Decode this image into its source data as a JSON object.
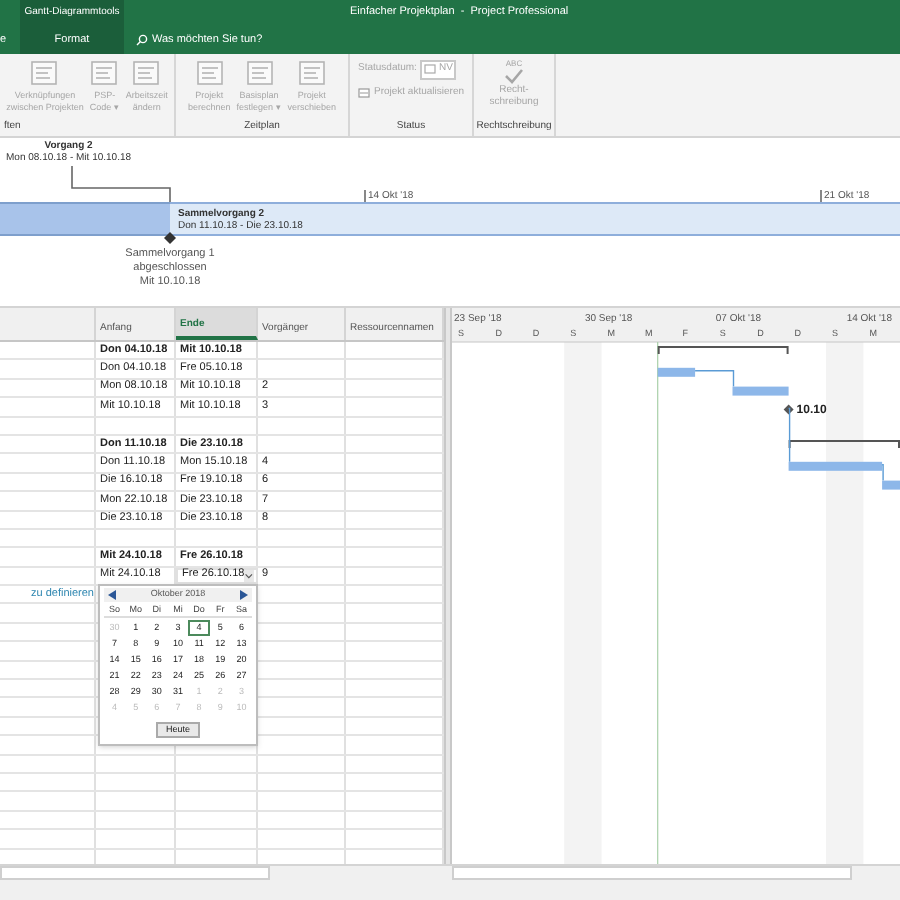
{
  "title_bar": {
    "tool_tab": "Gantt-Diagrammtools",
    "title": "Einfacher Projektplan  -  Project Professional"
  },
  "tabs": [
    {
      "label": "e",
      "selected": false
    },
    {
      "label": "Format",
      "selected": true
    }
  ],
  "search": {
    "placeholder": "Was möchten Sie tun?"
  },
  "ribbon": [
    {
      "kind": "buttons",
      "label": "ften",
      "buttons": [
        {
          "lines": [
            "Verknüpfungen",
            "zwischen Projekten"
          ],
          "disabled": true
        },
        {
          "lines": [
            "PSP-",
            "Code ▾"
          ],
          "disabled": true
        },
        {
          "lines": [
            "Arbeitszeit",
            "ändern"
          ],
          "disabled": true
        }
      ]
    },
    {
      "kind": "buttons",
      "label": "Zeitplan",
      "buttons": [
        {
          "lines": [
            "Projekt",
            "berechnen"
          ],
          "disabled": true
        },
        {
          "lines": [
            "Basisplan",
            "festlegen ▾"
          ],
          "disabled": true
        },
        {
          "lines": [
            "Projekt",
            "verschieben"
          ],
          "disabled": true
        }
      ]
    },
    {
      "kind": "status",
      "label": "Status",
      "date_label": "Statusdatum:",
      "date_value": "NV",
      "update": "Projekt aktualisieren",
      "disabled": true
    },
    {
      "kind": "spelling",
      "label": "Rechtschreibung",
      "badge": "ABC",
      "lines": [
        "Recht-",
        "schreibung"
      ],
      "disabled": true
    }
  ],
  "timeline": {
    "callout": {
      "title": "Vorgang 2",
      "dates": "Mon 08.10.18 - Mit 10.10.18"
    },
    "ticks": [
      "14 Okt '18",
      "21 Okt '18"
    ],
    "summary_bar": {
      "title": "Sammelvorgang 2",
      "dates": "Don 11.10.18 - Die 23.10.18"
    },
    "milestone": {
      "lines": [
        "Sammelvorgang 1",
        "abgeschlossen",
        "Mit 10.10.18"
      ]
    }
  },
  "table": {
    "columns": [
      {
        "label": "Anfang",
        "selected": false
      },
      {
        "label": "Ende",
        "selected": true
      },
      {
        "label": "Vorgänger",
        "selected": false
      },
      {
        "label": "Ressourcennamen",
        "selected": false
      }
    ],
    "rows": [
      {
        "kind": "summary",
        "start": "Don 04.10.18",
        "end": "Mit 10.10.18"
      },
      {
        "kind": "task",
        "start": "Don 04.10.18",
        "end": "Fre 05.10.18"
      },
      {
        "kind": "task",
        "start": "Mon 08.10.18",
        "end": "Mit 10.10.18",
        "pred": "2"
      },
      {
        "kind": "milestone",
        "start": "Mit 10.10.18",
        "end": "Mit 10.10.18",
        "pred": "3",
        "label": "10.10"
      },
      {
        "kind": "blank"
      },
      {
        "kind": "summary",
        "start": "Don 11.10.18",
        "end": "Die 23.10.18"
      },
      {
        "kind": "task",
        "start": "Don 11.10.18",
        "end": "Mon 15.10.18",
        "pred": "4"
      },
      {
        "kind": "task",
        "start": "Die 16.10.18",
        "end": "Fre 19.10.18",
        "pred": "6"
      },
      {
        "kind": "task",
        "start": "Mon 22.10.18",
        "end": "Die 23.10.18",
        "pred": "7"
      },
      {
        "kind": "milestone",
        "start": "Die 23.10.18",
        "end": "Die 23.10.18",
        "pred": "8"
      },
      {
        "kind": "blank"
      },
      {
        "kind": "summary",
        "start": "Mit 24.10.18",
        "end": "Fre 26.10.18"
      },
      {
        "kind": "task",
        "start": "Mit 24.10.18",
        "end": "Fre 26.10.18",
        "pred": "9",
        "editing": true
      }
    ],
    "hint": "zu definieren"
  },
  "calendar": {
    "month": "Oktober 2018",
    "weekdays": [
      "So",
      "Mo",
      "Di",
      "Mi",
      "Do",
      "Fr",
      "Sa"
    ],
    "weeks": [
      [
        {
          "d": "30",
          "muted": true,
          "selected": false
        },
        {
          "d": "1",
          "muted": false,
          "selected": false
        },
        {
          "d": "2",
          "muted": false,
          "selected": false
        },
        {
          "d": "3",
          "muted": false,
          "selected": false
        },
        {
          "d": "4",
          "muted": false,
          "selected": true
        },
        {
          "d": "5",
          "muted": false,
          "selected": false
        },
        {
          "d": "6",
          "muted": false,
          "selected": false
        }
      ],
      [
        {
          "d": "7",
          "muted": false,
          "selected": false
        },
        {
          "d": "8",
          "muted": false,
          "selected": false
        },
        {
          "d": "9",
          "muted": false,
          "selected": false
        },
        {
          "d": "10",
          "muted": false,
          "selected": false
        },
        {
          "d": "11",
          "muted": false,
          "selected": false
        },
        {
          "d": "12",
          "muted": false,
          "selected": false
        },
        {
          "d": "13",
          "muted": false,
          "selected": false
        }
      ],
      [
        {
          "d": "14",
          "muted": false,
          "selected": false
        },
        {
          "d": "15",
          "muted": false,
          "selected": false
        },
        {
          "d": "16",
          "muted": false,
          "selected": false
        },
        {
          "d": "17",
          "muted": false,
          "selected": false
        },
        {
          "d": "18",
          "muted": false,
          "selected": false
        },
        {
          "d": "19",
          "muted": false,
          "selected": false
        },
        {
          "d": "20",
          "muted": false,
          "selected": false
        }
      ],
      [
        {
          "d": "21",
          "muted": false,
          "selected": false
        },
        {
          "d": "22",
          "muted": false,
          "selected": false
        },
        {
          "d": "23",
          "muted": false,
          "selected": false
        },
        {
          "d": "24",
          "muted": false,
          "selected": false
        },
        {
          "d": "25",
          "muted": false,
          "selected": false
        },
        {
          "d": "26",
          "muted": false,
          "selected": false
        },
        {
          "d": "27",
          "muted": false,
          "selected": false
        }
      ],
      [
        {
          "d": "28",
          "muted": false,
          "selected": false
        },
        {
          "d": "29",
          "muted": false,
          "selected": false
        },
        {
          "d": "30",
          "muted": false,
          "selected": false
        },
        {
          "d": "31",
          "muted": false,
          "selected": false
        },
        {
          "d": "1",
          "muted": true,
          "selected": false
        },
        {
          "d": "2",
          "muted": true,
          "selected": false
        },
        {
          "d": "3",
          "muted": true,
          "selected": false
        }
      ],
      [
        {
          "d": "4",
          "muted": true,
          "selected": false
        },
        {
          "d": "5",
          "muted": true,
          "selected": false
        },
        {
          "d": "6",
          "muted": true,
          "selected": false
        },
        {
          "d": "7",
          "muted": true,
          "selected": false
        },
        {
          "d": "8",
          "muted": true,
          "selected": false
        },
        {
          "d": "9",
          "muted": true,
          "selected": false
        },
        {
          "d": "10",
          "muted": true,
          "selected": false
        }
      ]
    ],
    "today_button": "Heute"
  },
  "gantt": {
    "weeks": [
      "23 Sep '18",
      "30 Sep '18",
      "07 Okt '18",
      "14 Okt '18"
    ],
    "days": [
      "S",
      "D",
      "D",
      "S",
      "M",
      "M",
      "F",
      "S",
      "D",
      "D",
      "S",
      "M"
    ]
  }
}
